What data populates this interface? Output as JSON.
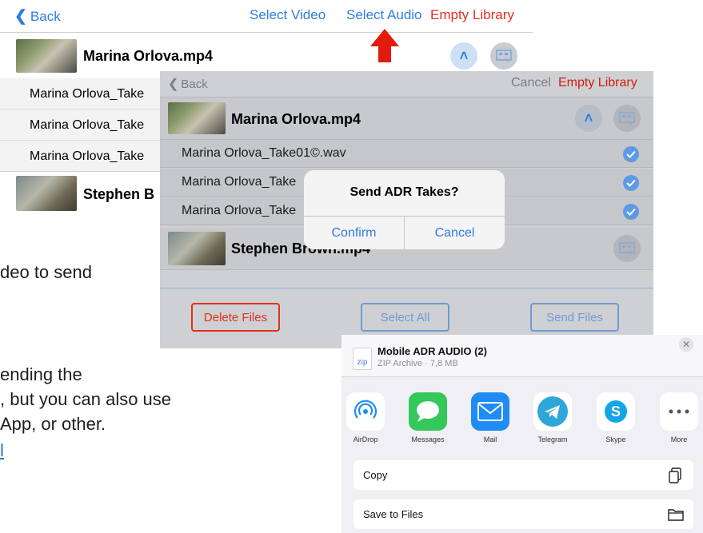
{
  "background_screen": {
    "back_label": "Back",
    "select_video": "Select Video",
    "select_audio": "Select Audio",
    "empty_library": "Empty Library",
    "video1_title": "Marina Orlova.mp4",
    "takes": [
      "Marina Orlova_Take",
      "Marina Orlova_Take",
      "Marina Orlova_Take"
    ],
    "video2_title": "Stephen B"
  },
  "article": {
    "line1": "deo to send",
    "line2": "ending the",
    "line3": ", but you can also use",
    "line4": "App, or other.",
    "line5": "l"
  },
  "panel": {
    "back_label": "Back",
    "cancel_label": "Cancel",
    "empty_library": "Empty Library",
    "video1_title": "Marina Orlova.mp4",
    "takes": [
      "Marina Orlova_Take01©.wav",
      "Marina Orlova_Take",
      "Marina Orlova_Take"
    ],
    "video2_title": "Stephen Brown.mp4",
    "delete_files": "Delete Files",
    "select_all": "Select All",
    "send_files": "Send Files"
  },
  "alert": {
    "title": "Send ADR Takes?",
    "confirm": "Confirm",
    "cancel": "Cancel"
  },
  "share_sheet": {
    "file_badge": "zip",
    "file_name": "Mobile ADR AUDIO (2)",
    "file_meta": "ZIP Archive · 7,8 MB",
    "apps": [
      {
        "name": "AirDrop",
        "icon": "airdrop-icon",
        "color": "#ffffff"
      },
      {
        "name": "Messages",
        "icon": "messages-icon",
        "color": "#34c759"
      },
      {
        "name": "Mail",
        "icon": "mail-icon",
        "color": "#1f8cf4"
      },
      {
        "name": "Telegram",
        "icon": "telegram-icon",
        "color": "#2ea6da"
      },
      {
        "name": "Skype",
        "icon": "skype-icon",
        "color": "#ffffff"
      },
      {
        "name": "More",
        "icon": "more-icon",
        "color": "#ffffff"
      }
    ],
    "copy": "Copy",
    "save_to_files": "Save to Files"
  },
  "colors": {
    "accent_blue": "#2f7ce0",
    "danger_red": "#e0301e",
    "arrow_red": "#e31b0c"
  }
}
